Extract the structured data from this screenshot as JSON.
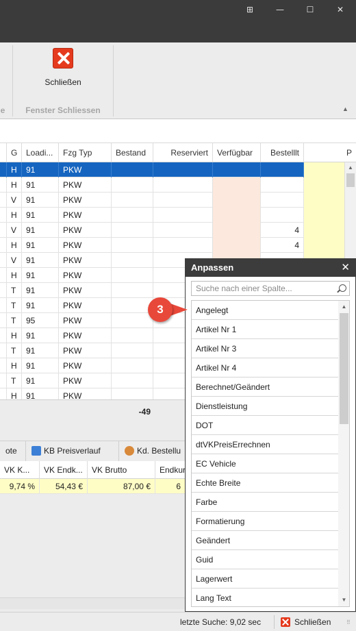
{
  "window": {
    "controls": [
      "⊞",
      "—",
      "☐",
      "✕"
    ]
  },
  "ribbon": {
    "close_label": "Schließen",
    "group_label": "Fenster Schliessen",
    "left_group_partial": "e"
  },
  "grid": {
    "columns": [
      "G",
      "Loadi...",
      "Fzg Typ",
      "Bestand",
      "Reserviert",
      "Verfügbar",
      "Bestelllt",
      "P"
    ],
    "rows": [
      {
        "g": "H",
        "load": "91",
        "typ": "PKW",
        "best": ""
      },
      {
        "g": "H",
        "load": "91",
        "typ": "PKW",
        "best": ""
      },
      {
        "g": "V",
        "load": "91",
        "typ": "PKW",
        "best": ""
      },
      {
        "g": "H",
        "load": "91",
        "typ": "PKW",
        "best": ""
      },
      {
        "g": "V",
        "load": "91",
        "typ": "PKW",
        "best": "4"
      },
      {
        "g": "H",
        "load": "91",
        "typ": "PKW",
        "best": "4"
      },
      {
        "g": "V",
        "load": "91",
        "typ": "PKW",
        "best": ""
      },
      {
        "g": "H",
        "load": "91",
        "typ": "PKW",
        "best": ""
      },
      {
        "g": "T",
        "load": "91",
        "typ": "PKW",
        "best": ""
      },
      {
        "g": "T",
        "load": "91",
        "typ": "PKW",
        "best": ""
      },
      {
        "g": "T",
        "load": "95",
        "typ": "PKW",
        "best": ""
      },
      {
        "g": "H",
        "load": "91",
        "typ": "PKW",
        "best": ""
      },
      {
        "g": "T",
        "load": "91",
        "typ": "PKW",
        "best": ""
      },
      {
        "g": "H",
        "load": "91",
        "typ": "PKW",
        "best": ""
      },
      {
        "g": "T",
        "load": "91",
        "typ": "PKW",
        "best": ""
      },
      {
        "g": "H",
        "load": "91",
        "typ": "PKW",
        "best": ""
      }
    ],
    "summary_value": "-49"
  },
  "tabs": [
    "ote",
    "KB Preisverlauf",
    "Kd. Bestellu"
  ],
  "lower_grid": {
    "columns": [
      "VK K...",
      "VK Endk...",
      "VK Brutto",
      "Endkur"
    ],
    "row": [
      "9,74 %",
      "54,43 €",
      "87,00 €",
      "6"
    ]
  },
  "panel": {
    "title": "Anpassen",
    "search_placeholder": "Suche nach einer Spalte...",
    "items": [
      "Angelegt",
      "Artikel Nr 1",
      "Artikel Nr 3",
      "Artikel Nr 4",
      "Berechnet/Geändert",
      "Dienstleistung",
      "DOT",
      "dtVKPreisErrechnen",
      "EC Vehicle",
      "Echte Breite",
      "Farbe",
      "Formatierung",
      "Geändert",
      "Guid",
      "Lagerwert",
      "Lang Text"
    ]
  },
  "callout": {
    "number": "3"
  },
  "status": {
    "search_time": "letzte Suche: 9,02 sec",
    "close_label": "Schließen"
  },
  "colors": {
    "selection": "#1565c0",
    "verfuegbar_bg": "#fce8dc",
    "p_bg": "#fffdc6",
    "close_red": "#e53a1e",
    "callout": "#e8483a"
  }
}
